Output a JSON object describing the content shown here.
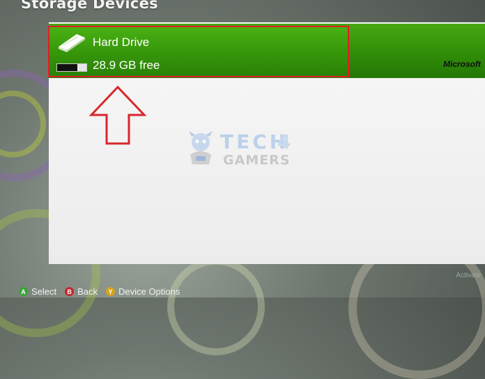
{
  "screen": {
    "title": "Storage Devices"
  },
  "device": {
    "name": "Hard Drive",
    "free_space": "28.9 GB free",
    "used_fraction": 0.7
  },
  "brand": {
    "logo_text": "Microsoft"
  },
  "watermark": {
    "line1": "TECH",
    "line1_accent": "4",
    "line2": "GAMERS"
  },
  "hints": [
    {
      "key": "A",
      "label": "Select",
      "color": "#3aa33a"
    },
    {
      "key": "B",
      "label": "Back",
      "color": "#c0282c"
    },
    {
      "key": "Y",
      "label": "Device Options",
      "color": "#d2a418"
    }
  ],
  "corner": {
    "text": "Activate"
  },
  "colors": {
    "accent_green": "#35950a",
    "highlight_red": "#e01d25",
    "panel": "#f2f2f2"
  },
  "icons": {
    "device": "hard-drive-icon",
    "pointer": "up-arrow-icon"
  }
}
